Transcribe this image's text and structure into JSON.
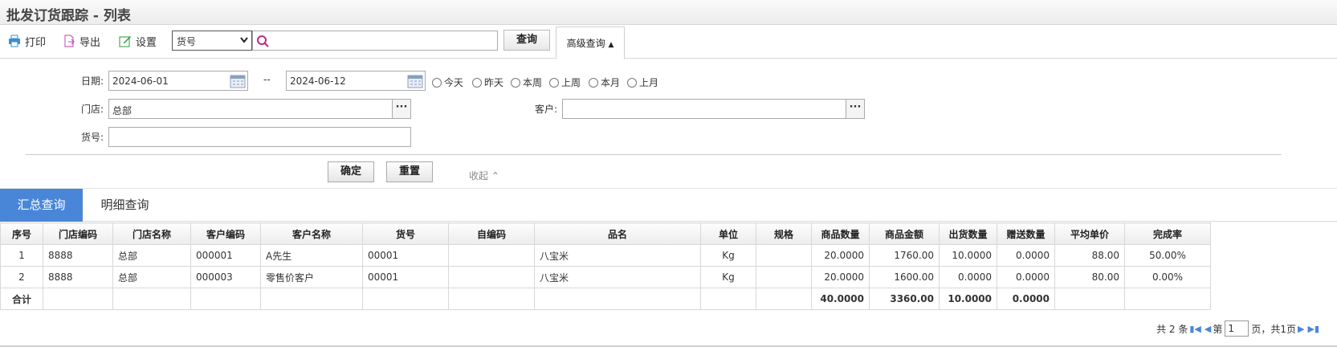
{
  "title": "批发订货跟踪 - 列表",
  "toolbar": {
    "print": "打印",
    "export": "导出",
    "settings": "设置",
    "field_select": "货号",
    "search_value": "",
    "query": "查询",
    "advanced": "高级查询"
  },
  "filter": {
    "date_label": "日期:",
    "date_from": "2024-06-01",
    "date_sep": "--",
    "date_to": "2024-06-12",
    "quick": [
      "今天",
      "昨天",
      "本周",
      "上周",
      "本月",
      "上月"
    ],
    "store_label": "门店:",
    "store_value": "总部",
    "customer_label": "客户:",
    "customer_value": "",
    "sku_label": "货号:",
    "sku_value": "",
    "confirm": "确定",
    "reset": "重置",
    "collapse": "收起"
  },
  "tabs": [
    "汇总查询",
    "明细查询"
  ],
  "table": {
    "headers": [
      "序号",
      "门店编码",
      "门店名称",
      "客户编码",
      "客户名称",
      "货号",
      "自编码",
      "品名",
      "单位",
      "规格",
      "商品数量",
      "商品金额",
      "出货数量",
      "赠送数量",
      "平均单价",
      "完成率"
    ],
    "rows": [
      [
        "1",
        "8888",
        "总部",
        "000001",
        "A先生",
        "00001",
        "",
        "八宝米",
        "Kg",
        "",
        "20.0000",
        "1760.00",
        "10.0000",
        "0.0000",
        "88.00",
        "50.00%"
      ],
      [
        "2",
        "8888",
        "总部",
        "000003",
        "零售价客户",
        "00001",
        "",
        "八宝米",
        "Kg",
        "",
        "20.0000",
        "1600.00",
        "0.0000",
        "0.0000",
        "80.00",
        "0.00%"
      ]
    ],
    "footer": {
      "label": "合计",
      "qty": "40.0000",
      "amount": "3360.00",
      "shipped": "10.0000",
      "gift": "0.0000"
    }
  },
  "pager": {
    "total": "共 2 条",
    "page_prefix": "第",
    "page": "1",
    "page_suffix": "页，共1页"
  },
  "colors": {
    "accent": "#4a86d8"
  }
}
